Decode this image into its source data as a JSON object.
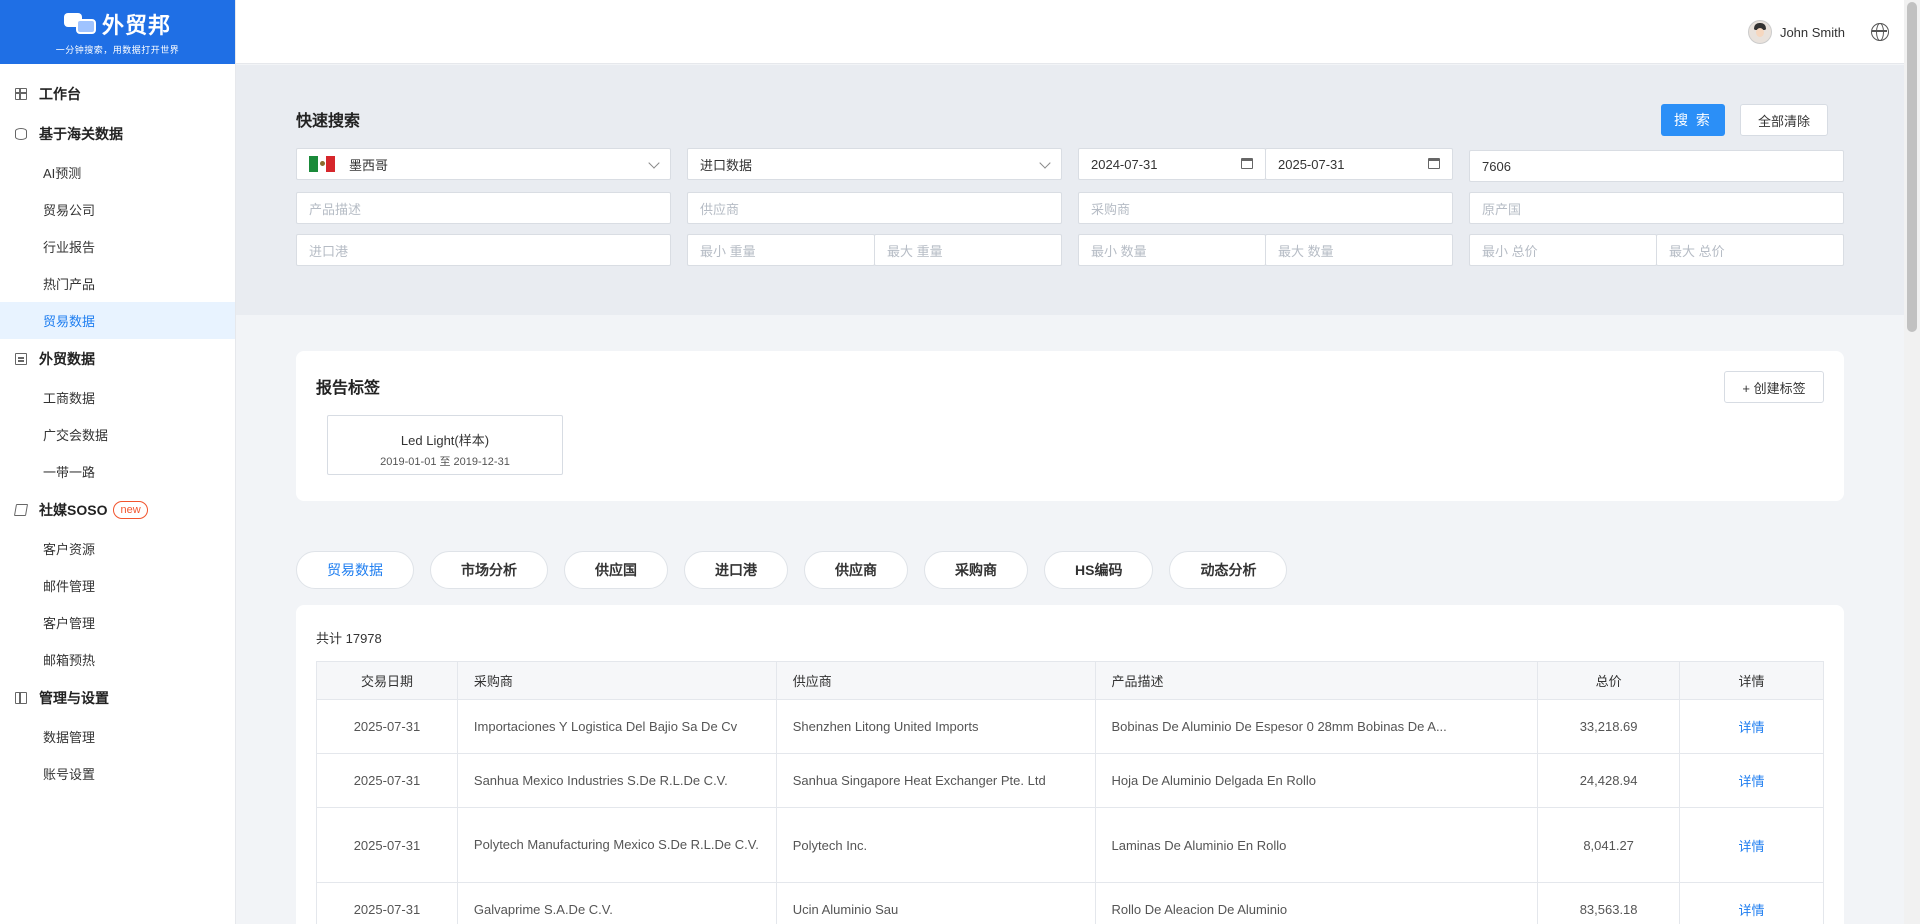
{
  "brand": {
    "name": "外贸邦",
    "slogan": "一分钟搜索，用数据打开世界"
  },
  "sidebar": {
    "groups": [
      {
        "label": "工作台",
        "items": []
      },
      {
        "label": "基于海关数据",
        "items": [
          "AI预测",
          "贸易公司",
          "行业报告",
          "热门产品",
          "贸易数据"
        ]
      },
      {
        "label": "外贸数据",
        "items": [
          "工商数据",
          "广交会数据",
          "一带一路"
        ]
      },
      {
        "label": "社媒SOSO",
        "badge": "new",
        "items": [
          "客户资源",
          "邮件管理",
          "客户管理",
          "邮箱预热"
        ]
      },
      {
        "label": "管理与设置",
        "items": [
          "数据管理",
          "账号设置"
        ]
      }
    ],
    "active_item": "贸易数据"
  },
  "header": {
    "user_name": "John Smith"
  },
  "search": {
    "title": "快速搜索",
    "search_label": "搜 索",
    "clear_label": "全部清除",
    "country": "墨西哥",
    "data_type": "进口数据",
    "date_start": "2024-07-31",
    "date_end": "2025-07-31",
    "hs_code": "7606",
    "ph_product": "产品描述",
    "ph_supplier": "供应商",
    "ph_buyer": "采购商",
    "ph_origin": "原产国",
    "ph_port": "进口港",
    "ph_min_weight": "最小 重量",
    "ph_max_weight": "最大 重量",
    "ph_min_qty": "最小 数量",
    "ph_max_qty": "最大 数量",
    "ph_min_price": "最小 总价",
    "ph_max_price": "最大 总价"
  },
  "tags": {
    "title": "报告标签",
    "create_label": "+ 创建标签",
    "items": [
      {
        "name": "Led Light(样本)",
        "range": "2019-01-01 至 2019-12-31"
      }
    ]
  },
  "tabs": [
    "贸易数据",
    "市场分析",
    "供应国",
    "进口港",
    "供应商",
    "采购商",
    "HS编码",
    "动态分析"
  ],
  "table": {
    "total": "共计 17978",
    "headers": [
      "交易日期",
      "采购商",
      "供应商",
      "产品描述",
      "总价",
      "详情"
    ],
    "detail_label": "详情",
    "rows": [
      {
        "date": "2025-07-31",
        "buyer": "Importaciones Y Logistica Del Bajio Sa De Cv",
        "supplier": "Shenzhen Litong United Imports",
        "product": "Bobinas De Aluminio De Espesor 0 28mm Bobinas De A...",
        "price": "33,218.69"
      },
      {
        "date": "2025-07-31",
        "buyer": "Sanhua Mexico Industries S.De R.L.De C.V.",
        "supplier": "Sanhua Singapore Heat Exchanger Pte. Ltd",
        "product": "Hoja De Aluminio Delgada En Rollo",
        "price": "24,428.94"
      },
      {
        "date": "2025-07-31",
        "buyer": "Polytech Manufacturing Mexico S.De R.L.De C.V.",
        "supplier": "Polytech Inc.",
        "product": "Laminas De Aluminio En Rollo",
        "price": "8,041.27"
      },
      {
        "date": "2025-07-31",
        "buyer": "Galvaprime S.A.De C.V.",
        "supplier": "Ucin Aluminio Sau",
        "product": "Rollo De Aleacion De Aluminio",
        "price": "83,563.18"
      }
    ]
  }
}
